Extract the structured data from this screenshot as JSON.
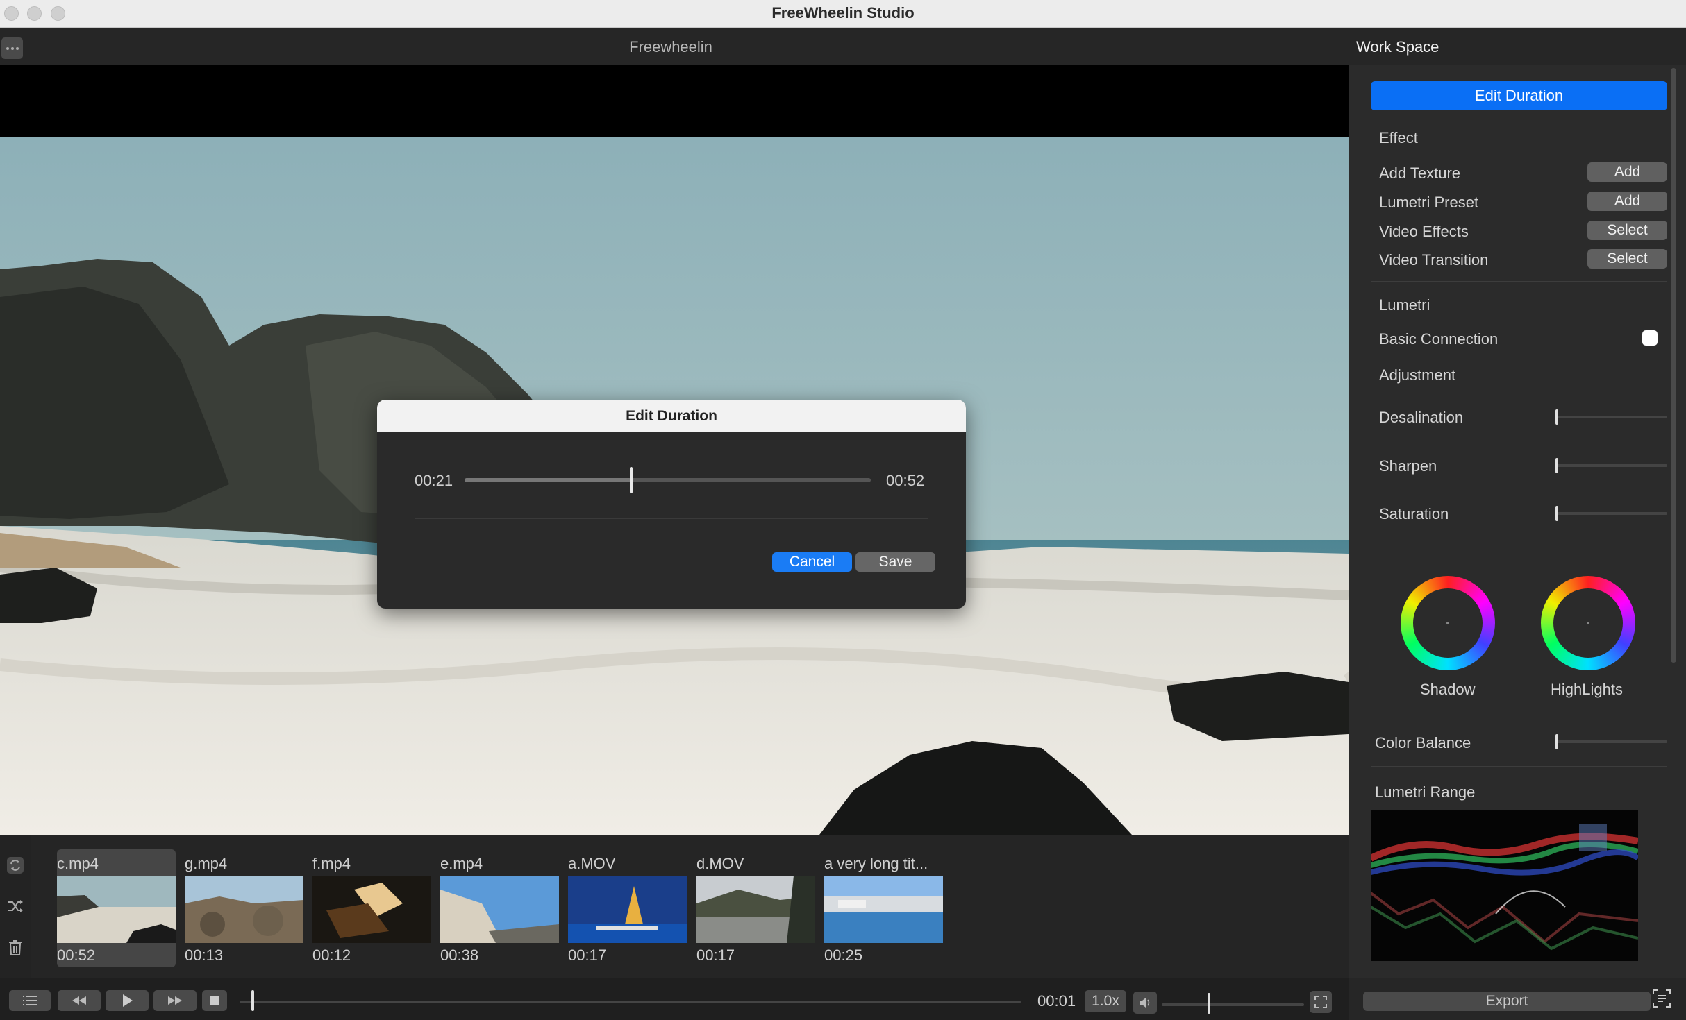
{
  "window": {
    "title": "FreeWheelin Studio"
  },
  "viewer": {
    "title": "Freewheelin"
  },
  "dialog": {
    "title": "Edit Duration",
    "start_time": "00:21",
    "end_time": "00:52",
    "slider_fraction": 0.41,
    "cancel_label": "Cancel",
    "save_label": "Save"
  },
  "clips": [
    {
      "name": "c.mp4",
      "duration": "00:52",
      "selected": true
    },
    {
      "name": "g.mp4",
      "duration": "00:13",
      "selected": false
    },
    {
      "name": "f.mp4",
      "duration": "00:12",
      "selected": false
    },
    {
      "name": "e.mp4",
      "duration": "00:38",
      "selected": false
    },
    {
      "name": "a.MOV",
      "duration": "00:17",
      "selected": false
    },
    {
      "name": "d.MOV",
      "duration": "00:17",
      "selected": false
    },
    {
      "name": "a very long tit...",
      "duration": "00:25",
      "selected": false
    }
  ],
  "playback": {
    "current_time": "00:01",
    "speed": "1.0x",
    "timeline_fraction": 0.015,
    "volume_fraction": 0.32
  },
  "workspace": {
    "title": "Work Space",
    "edit_duration_label": "Edit Duration",
    "effect_heading": "Effect",
    "effects": [
      {
        "label": "Add Texture",
        "button": "Add"
      },
      {
        "label": "Lumetri Preset",
        "button": "Add"
      },
      {
        "label": "Video Effects",
        "button": "Select"
      },
      {
        "label": "Video Transition",
        "button": "Select"
      }
    ],
    "lumetri_heading": "Lumetri",
    "basic_connection_label": "Basic Connection",
    "basic_connection_checked": false,
    "adjustment_heading": "Adjustment",
    "adjustments": [
      {
        "label": "Desalination",
        "value": 0.0
      },
      {
        "label": "Sharpen",
        "value": 0.0
      },
      {
        "label": "Saturation",
        "value": 0.0
      }
    ],
    "wheels": [
      {
        "label": "Shadow"
      },
      {
        "label": "HighLights"
      }
    ],
    "color_balance_label": "Color Balance",
    "color_balance_value": 0.0,
    "lumetri_range_label": "Lumetri Range",
    "export_label": "Export"
  },
  "icons": {
    "menu": "more-dots-icon",
    "loop": "loop-icon",
    "shuffle": "shuffle-icon",
    "trash": "trash-icon",
    "list": "list-icon",
    "rewind": "rewind-icon",
    "play": "play-icon",
    "forward": "fast-forward-icon",
    "stop": "stop-icon",
    "volume": "volume-icon",
    "fullscreen": "fullscreen-icon",
    "caption": "caption-icon"
  },
  "colors": {
    "accent": "#0a6ff5",
    "panel": "#2b2b2b",
    "background": "#1e1e1e"
  }
}
